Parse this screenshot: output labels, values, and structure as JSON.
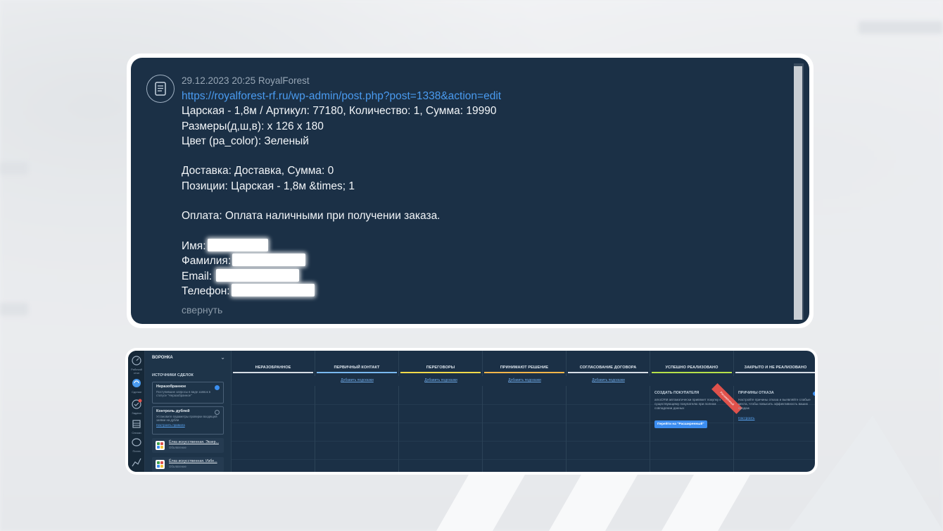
{
  "message": {
    "meta": "29.12.2023 20:25 RoyalForest",
    "link": "https://royalforest-rf.ru/wp-admin/post.php?post=1338&action=edit",
    "line1": "Царская - 1,8м / Артикул: 77180, Количество: 1, Сумма: 19990",
    "line2": "Размеры(д,ш,в): x 126 x 180",
    "line3": "Цвет (pa_color): Зеленый",
    "line4": "Доставка: Доставка, Сумма: 0",
    "line5": "Позиции: Царская - 1,8м &times; 1",
    "line6": "Оплата: Оплата наличными при получении заказа.",
    "name_label": "Имя:",
    "surname_label": "Фамилия:",
    "email_label": "Email:",
    "phone_label": "Телефон:",
    "collapse": "свернуть",
    "icon": "document-icon"
  },
  "crm": {
    "funnel_title": "ВОРОНКА",
    "sources_title": "ИСТОЧНИКИ СДЕЛОК",
    "unsorted": {
      "title": "Неразобранное",
      "desc": "Поступившие запросы в виде заявок в статусе \"Неразобранное\""
    },
    "dupes": {
      "title": "Контроль дублей",
      "desc": "Установите параметры проверки входящей заявки на дубли",
      "link": "Настроить правила"
    },
    "integrations": [
      {
        "title": "Ёлка искусственная. Экзер...",
        "sub": "Объявление"
      },
      {
        "title": "Ёлка искусственная. Избе...",
        "sub": "Объявление"
      }
    ],
    "rail": [
      "Рабочий стол",
      "Сделки",
      "Задачи",
      "Списки",
      "Почта"
    ],
    "columns": [
      {
        "name": "НЕРАЗОБРАННОЕ",
        "color": "#d6dde5",
        "add": ""
      },
      {
        "name": "ПЕРВИЧНЫЙ КОНТАКТ",
        "color": "#79b8ef",
        "add": "Добавить подсказки"
      },
      {
        "name": "ПЕРЕГОВОРЫ",
        "color": "#f2d94a",
        "add": "Добавить подсказки"
      },
      {
        "name": "ПРИНИМАЮТ РЕШЕНИЕ",
        "color": "#f3b54a",
        "add": "Добавить подсказки"
      },
      {
        "name": "СОГЛАСОВАНИЕ ДОГОВОРА",
        "color": "#d6dde5",
        "add": "Добавить подсказки"
      },
      {
        "name": "УСПЕШНО РЕАЛИЗОВАНО",
        "color": "#b6e14a",
        "add": ""
      },
      {
        "name": "ЗАКРЫТО И НЕ РЕАЛИЗОВАНО",
        "color": "#d6dde5",
        "add": ""
      }
    ],
    "create_buyer": {
      "title": "СОЗДАТЬ ПОКУПАТЕЛЯ",
      "text": "amoCRM автоматически привяжет покупку к существующему покупателю при полном совпадении данных",
      "button": "Перейти на \"Расширенный\"",
      "ribbon": "Расширенный"
    },
    "reasons": {
      "title": "ПРИЧИНЫ ОТКАЗА",
      "text": "Настройте причины отказа и выявляйте слабые места, чтобы повысить эффективность ваших продаж",
      "link": "Настроить"
    }
  }
}
